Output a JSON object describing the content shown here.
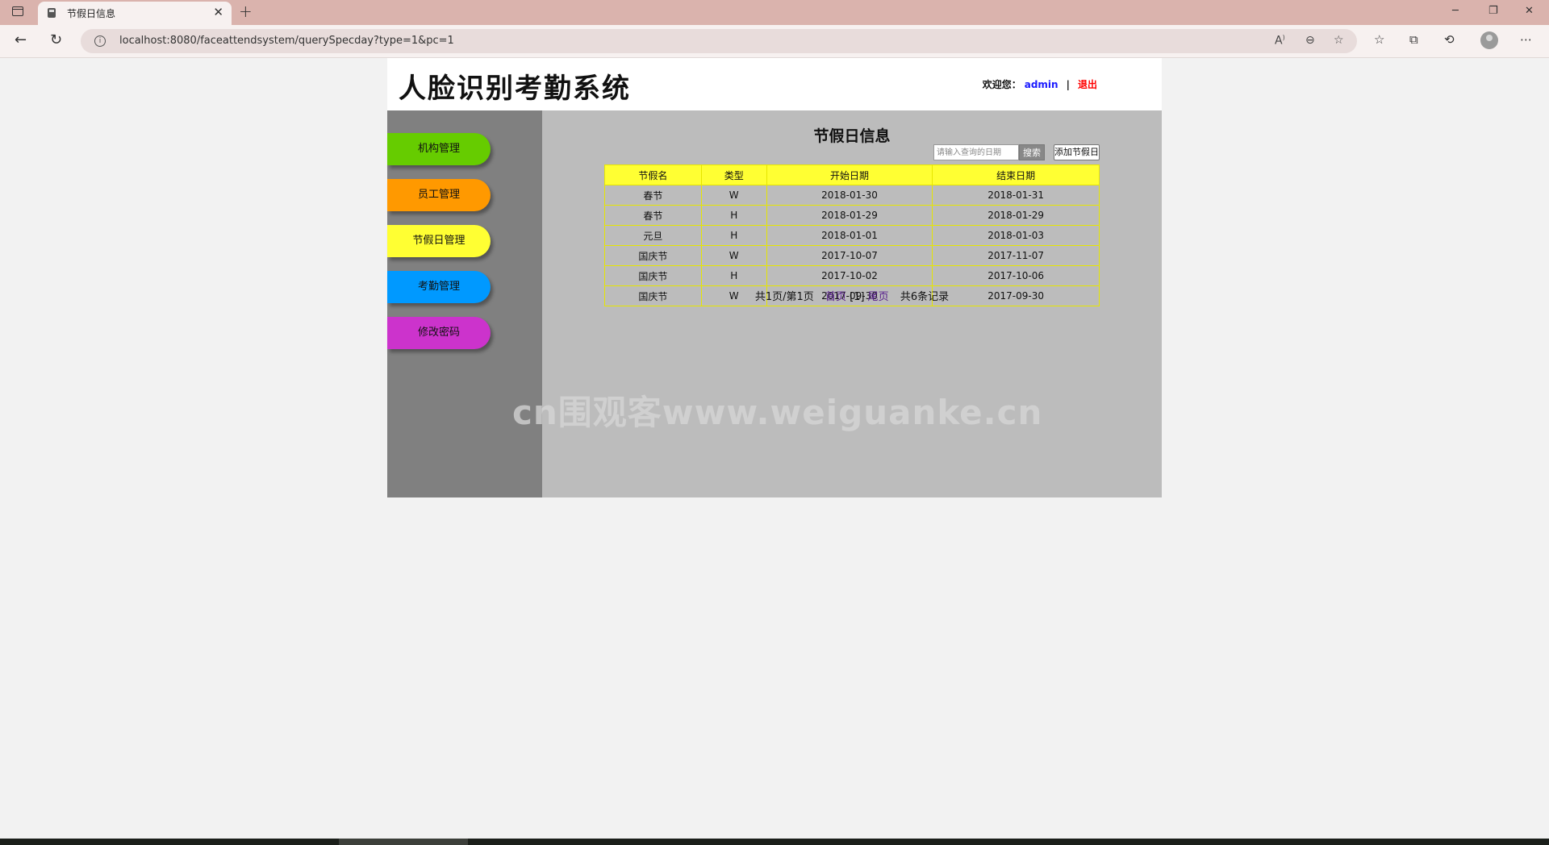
{
  "browser": {
    "tab_title": "节假日信息",
    "url": "localhost:8080/faceattendsystem/querySpecday?type=1&pc=1"
  },
  "header": {
    "logo": "人脸识别考勤系统",
    "welcome": "欢迎您：",
    "username": "admin",
    "separator": "|",
    "logout": "退出"
  },
  "menu": [
    {
      "label": "机构管理",
      "color": "#66cc00"
    },
    {
      "label": "员工管理",
      "color": "#ff9900"
    },
    {
      "label": "节假日管理",
      "color": "#ffff33"
    },
    {
      "label": "考勤管理",
      "color": "#0099ff"
    },
    {
      "label": "修改密码",
      "color": "#cc33cc"
    }
  ],
  "main": {
    "title": "节假日信息",
    "search_placeholder": "请输入查询的日期",
    "search_button": "搜索",
    "add_button": "添加节假日"
  },
  "table": {
    "headers": [
      "节假名",
      "类型",
      "开始日期",
      "结束日期"
    ],
    "rows": [
      [
        "春节",
        "W",
        "2018-01-30",
        "2018-01-31"
      ],
      [
        "春节",
        "H",
        "2018-01-29",
        "2018-01-29"
      ],
      [
        "元旦",
        "H",
        "2018-01-01",
        "2018-01-03"
      ],
      [
        "国庆节",
        "W",
        "2017-10-07",
        "2017-11-07"
      ],
      [
        "国庆节",
        "H",
        "2017-10-02",
        "2017-10-06"
      ],
      [
        "国庆节",
        "W",
        "2017-09-30",
        "2017-09-30"
      ]
    ]
  },
  "pager": {
    "summary": "共1页/第1页",
    "first": "首页",
    "current": "[1]",
    "last": "尾页",
    "total": "共6条记录"
  },
  "watermark": "cn围观客www.weiguanke.cn"
}
